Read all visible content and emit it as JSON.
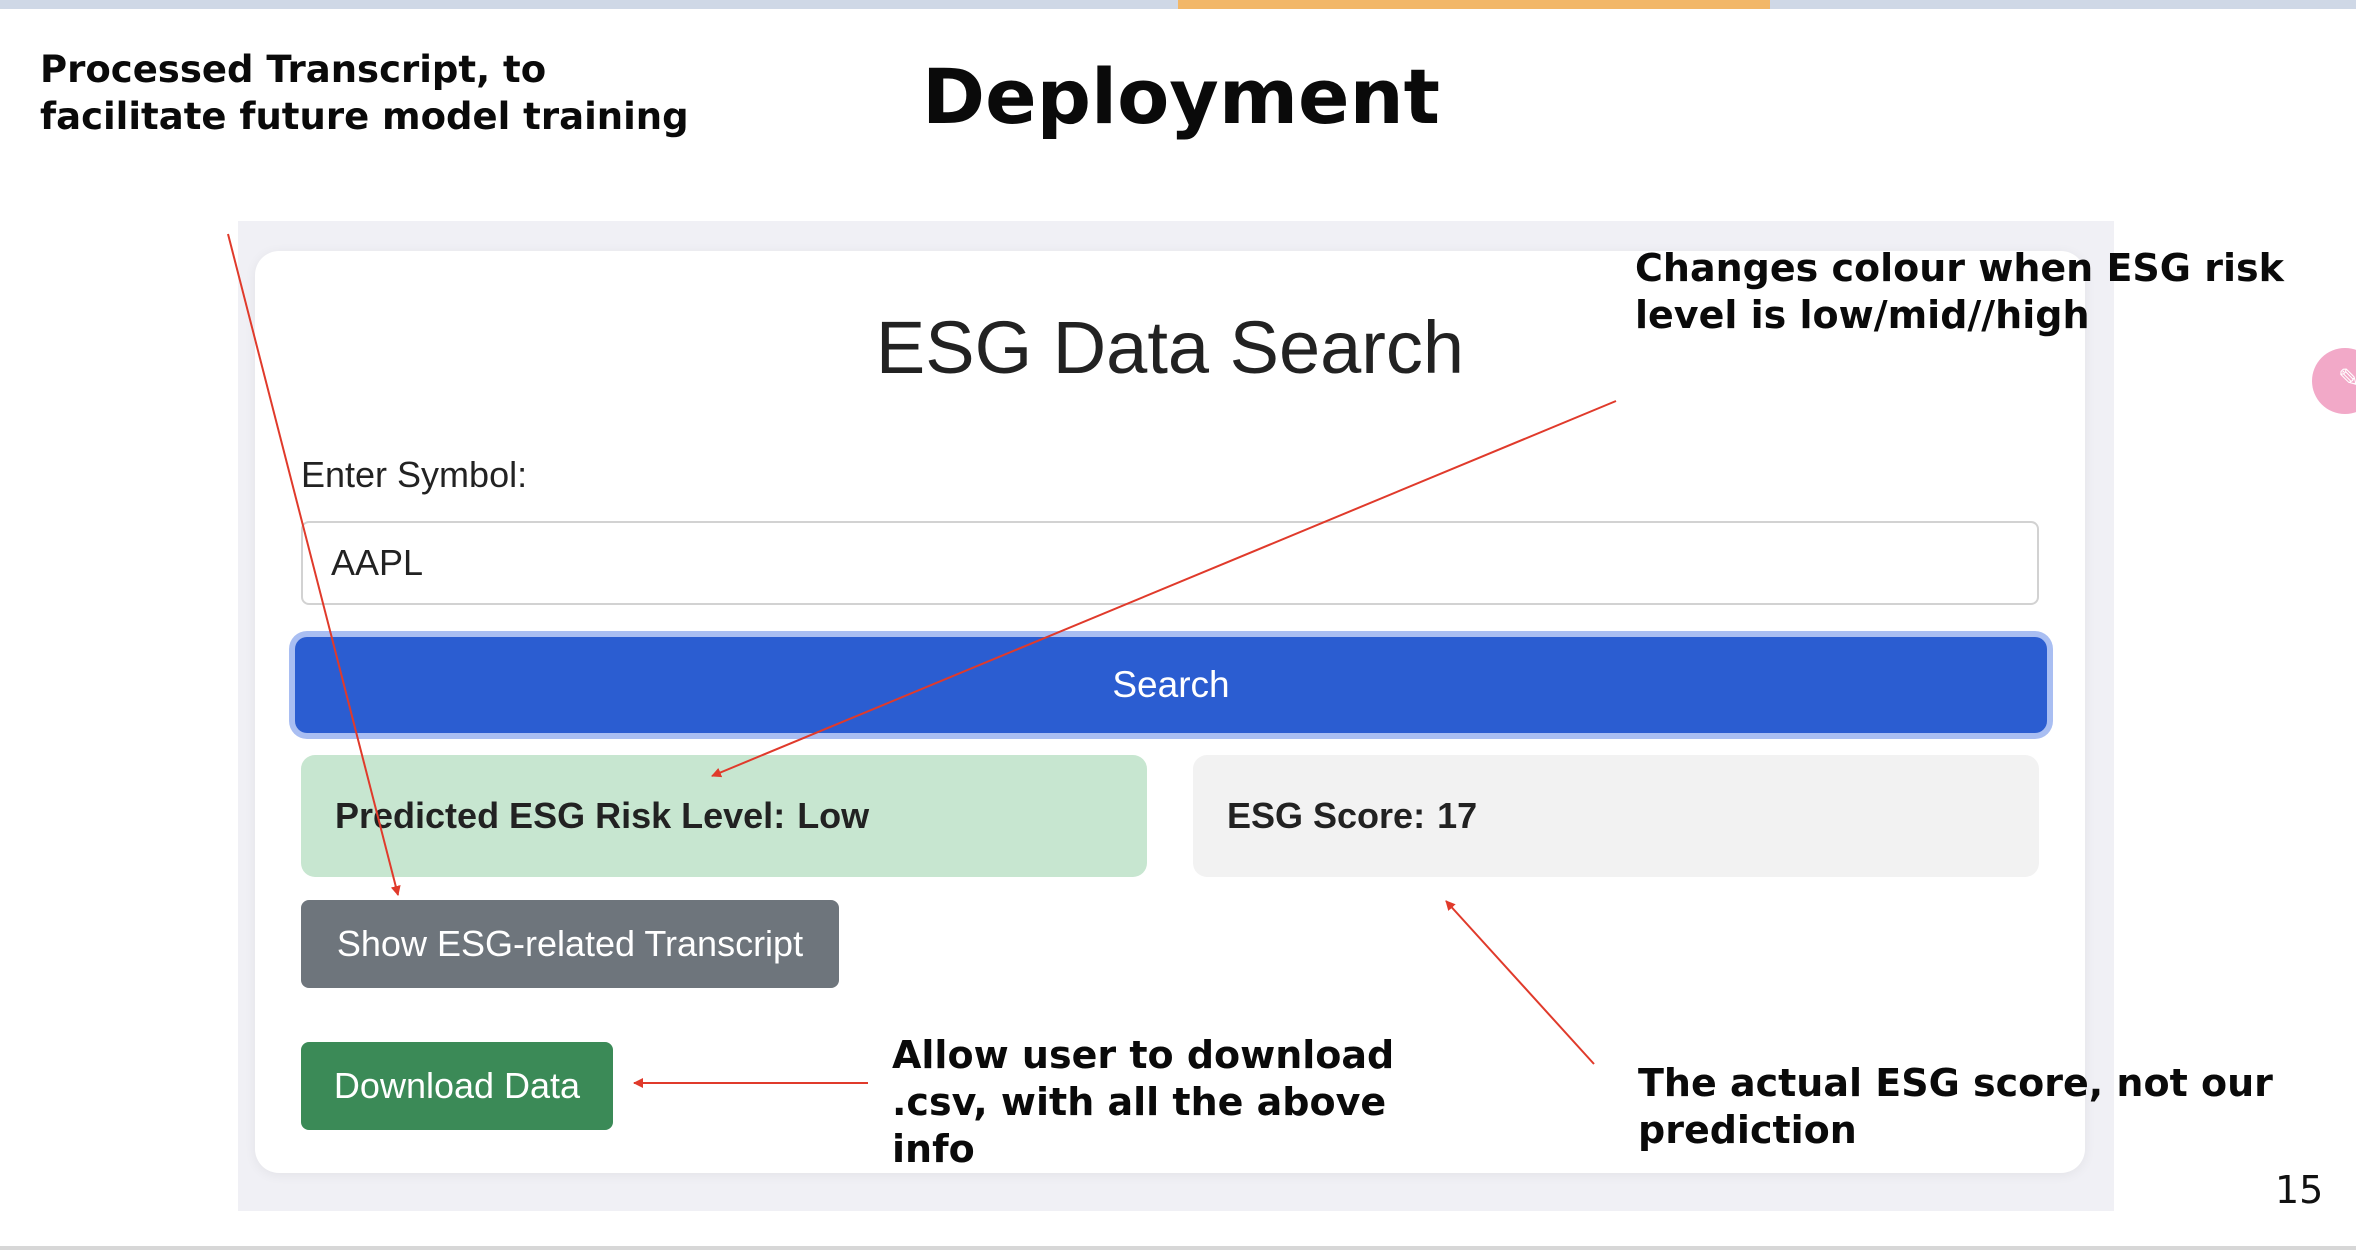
{
  "slide": {
    "title": "Deployment",
    "page_number": "15"
  },
  "annotations": {
    "transcript_note": "Processed Transcript, to\nfacilitate future model training",
    "colour_note": "Changes colour when ESG risk\nlevel is low/mid//high",
    "download_note": "Allow user to download\n.csv, with all the above\ninfo",
    "actual_score_note": "The actual ESG score, not our\nprediction"
  },
  "app": {
    "title": "ESG Data Search",
    "symbol_label": "Enter Symbol:",
    "symbol_value": "AAPL",
    "search_label": "Search",
    "risk_label": "Predicted ESG Risk Level:",
    "risk_value": "Low",
    "score_label": "ESG Score:",
    "score_value": "17",
    "transcript_button": "Show ESG-related Transcript",
    "download_button": "Download Data"
  },
  "colors": {
    "search_button": "#2b5dd1",
    "risk_low_background": "#c7e6d0",
    "transcript_button": "#6e757c",
    "download_button": "#3b8a57",
    "arrow": "#e03a2b"
  },
  "side_widget": {
    "icon": "chat-icon"
  }
}
